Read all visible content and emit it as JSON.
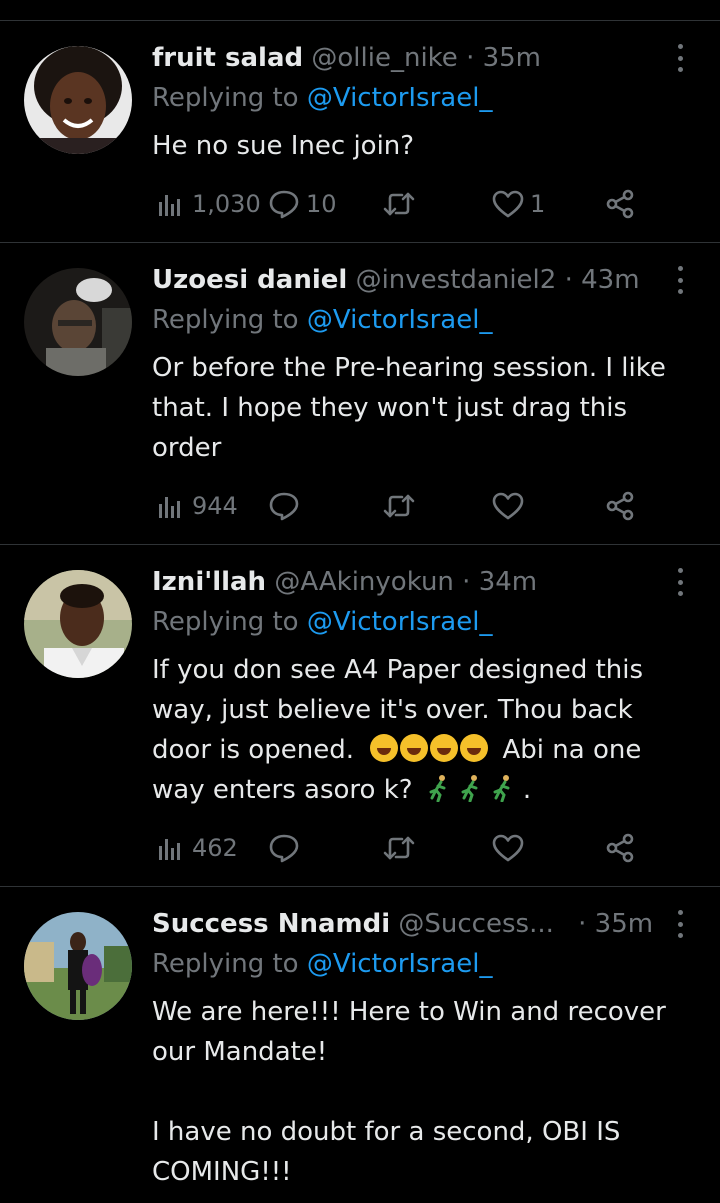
{
  "tweets": [
    {
      "name": "fruit salad",
      "handle": "@ollie_nike",
      "dot": "·",
      "time": "35m",
      "reply_prefix": "Replying to",
      "reply_to": "@VictorIsrael_",
      "body": [
        "He no sue Inec join?"
      ],
      "views": "1,030",
      "replies": "10",
      "retweets": "",
      "likes": "1"
    },
    {
      "name": "Uzoesi daniel",
      "handle": "@investdaniel2",
      "dot": "·",
      "time": "43m",
      "reply_prefix": "Replying to",
      "reply_to": "@VictorIsrael_",
      "body": [
        "Or before the Pre-hearing session. I like",
        "that. I hope they won't just drag this",
        "order"
      ],
      "views": "944",
      "replies": "",
      "retweets": "",
      "likes": ""
    },
    {
      "name": "Izni'llah",
      "handle": "@AAkinyokun",
      "dot": "·",
      "time": "34m",
      "reply_prefix": "Replying to",
      "reply_to": "@VictorIsrael_",
      "body_lines": [
        "If you don see A4 Paper designed this",
        "way, just believe it's over. Thou back",
        "door is opened.",
        "Abi na one",
        "way enters asoro k?",
        "."
      ],
      "views": "462",
      "replies": "",
      "retweets": "",
      "likes": ""
    },
    {
      "name": "Success Nnamdi",
      "handle": "@Success...",
      "dot": "·",
      "time": "35m",
      "reply_prefix": "Replying to",
      "reply_to": "@VictorIsrael_",
      "body": [
        "We are here!!! Here to Win and recover",
        "our Mandate!",
        "",
        "I have no doubt for a second, OBI IS",
        "COMING!!!"
      ]
    }
  ],
  "icons": {
    "views": "bar-chart-icon",
    "reply": "speech-bubble-icon",
    "retweet": "retweet-icon",
    "like": "heart-icon",
    "share": "share-icon",
    "more": "vertical-dots-icon"
  },
  "colors": {
    "background": "#000000",
    "text": "#e7e9ea",
    "muted": "#71767b",
    "accent": "#1d9bf0",
    "divider": "#2f3336"
  }
}
